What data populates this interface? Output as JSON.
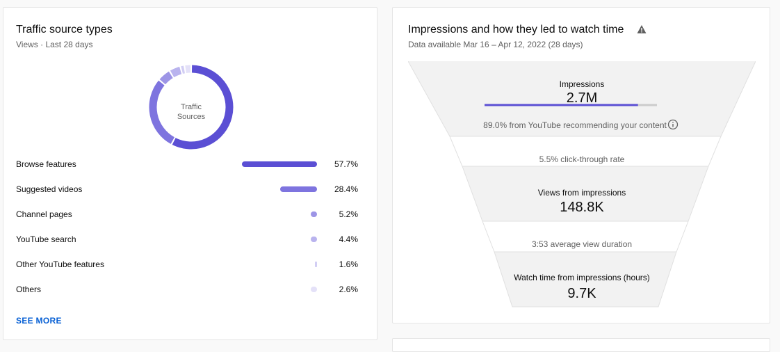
{
  "traffic": {
    "title": "Traffic source types",
    "subtitle": "Views · Last 28 days",
    "donut_center": [
      "Traffic",
      "Sources"
    ],
    "rows": [
      {
        "label": "Browse features",
        "value": "57.7%",
        "pct": 57.7,
        "color": "#5b4fd4"
      },
      {
        "label": "Suggested videos",
        "value": "28.4%",
        "pct": 28.4,
        "color": "#7e74df"
      },
      {
        "label": "Channel pages",
        "value": "5.2%",
        "pct": 5.2,
        "color": "#9d95e6"
      },
      {
        "label": "YouTube search",
        "value": "4.4%",
        "pct": 4.4,
        "color": "#b9b3ee"
      },
      {
        "label": "Other YouTube features",
        "value": "1.6%",
        "pct": 1.6,
        "color": "#d2cef4"
      },
      {
        "label": "Others",
        "value": "2.6%",
        "pct": 2.6,
        "color": "#e4e1f8"
      }
    ],
    "see_more": "SEE MORE"
  },
  "impressions": {
    "title": "Impressions and how they led to watch time",
    "subtitle": "Data available Mar 16 – Apr 12, 2022 (28 days)",
    "impr_label": "Impressions",
    "impr_value": "2.7M",
    "impr_rec_fraction": 0.89,
    "impr_note": "89.0% from YouTube recommending your content",
    "ctr": "5.5% click-through rate",
    "views_label": "Views from impressions",
    "views_value": "148.8K",
    "avd": "3:53 average view duration",
    "wt_label": "Watch time from impressions (hours)",
    "wt_value": "9.7K"
  },
  "colors": {
    "accent": "#5b4fd4",
    "funnel_fill": "#f2f2f2",
    "link": "#065fd4"
  }
}
